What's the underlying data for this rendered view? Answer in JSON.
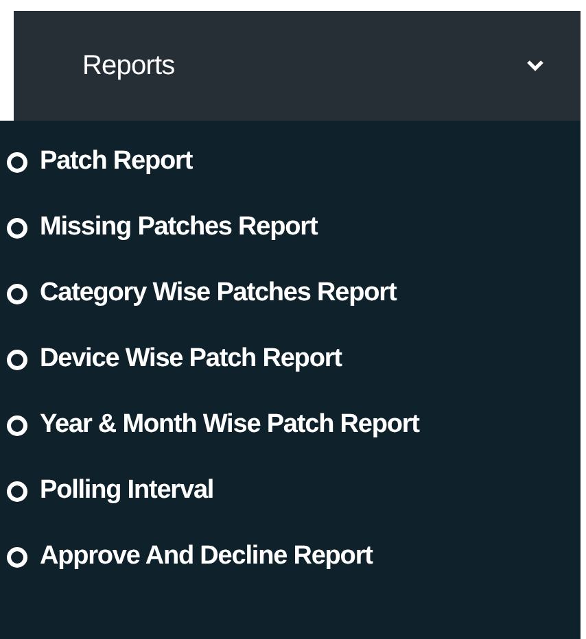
{
  "menu": {
    "title": "Reports",
    "expanded": true,
    "items": [
      {
        "label": "Patch Report"
      },
      {
        "label": "Missing Patches Report"
      },
      {
        "label": "Category Wise Patches Report"
      },
      {
        "label": "Device Wise Patch Report"
      },
      {
        "label": "Year & Month Wise Patch Report"
      },
      {
        "label": "Polling Interval"
      },
      {
        "label": "Approve And Decline Report"
      }
    ]
  }
}
